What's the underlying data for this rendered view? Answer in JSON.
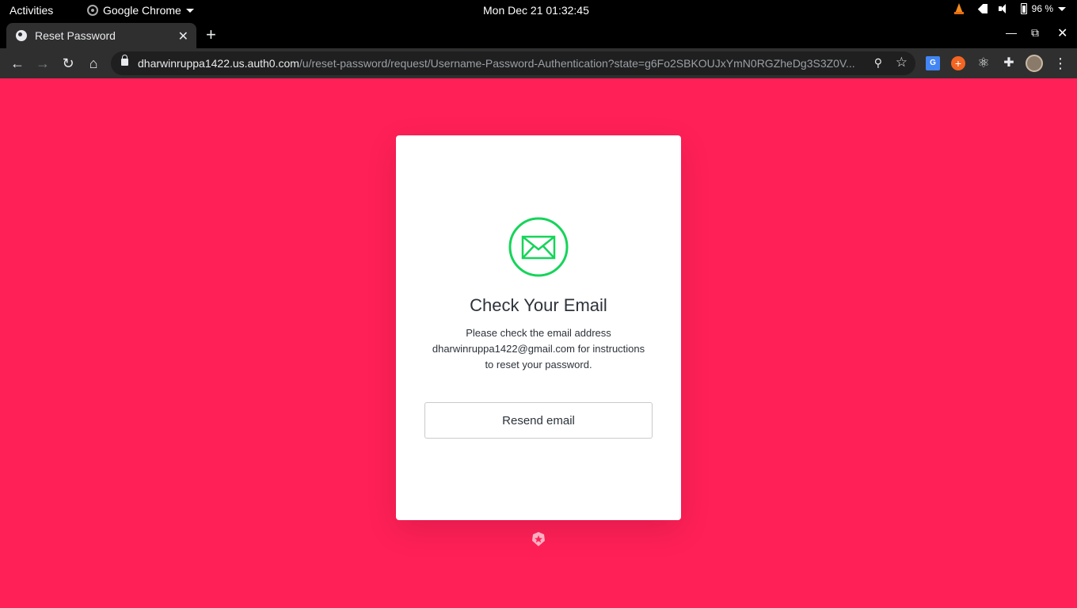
{
  "system_bar": {
    "activities": "Activities",
    "app_name": "Google Chrome",
    "clock": "Mon Dec 21  01:32:45",
    "battery": "96 %"
  },
  "browser": {
    "tab_title": "Reset Password",
    "url_host": "dharwinruppa1422.us.auth0.com",
    "url_path": "/u/reset-password/request/Username-Password-Authentication?state=g6Fo2SBKOUJxYmN0RGZheDg3S3Z0V..."
  },
  "card": {
    "title": "Check Your Email",
    "description": "Please check the email address dharwinruppa1422@gmail.com for instructions to reset your password.",
    "resend_label": "Resend email"
  },
  "colors": {
    "page_background": "#ff2057",
    "icon_green": "#16d45a"
  },
  "icons": [
    "mail-icon",
    "auth0-logo-icon",
    "lock-icon",
    "star-icon",
    "zoom-icon"
  ]
}
